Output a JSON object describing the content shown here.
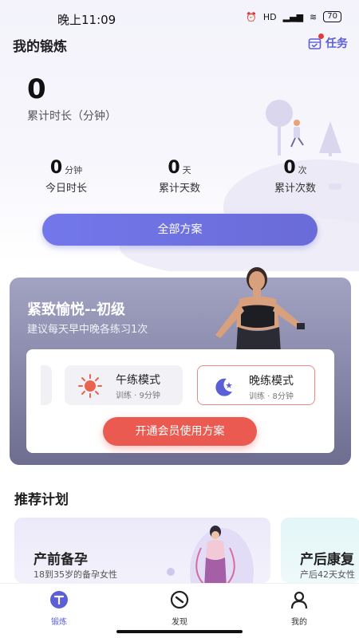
{
  "status_bar": {
    "time": "晚上11:09",
    "battery": "70",
    "hd": "HD"
  },
  "header": {
    "title": "我的锻炼",
    "task_label": "任务"
  },
  "summary": {
    "total_value": "0",
    "total_label": "累计时长（分钟）"
  },
  "stats": [
    {
      "value": "0",
      "unit": "分钟",
      "label": "今日时长"
    },
    {
      "value": "0",
      "unit": "天",
      "label": "累计天数"
    },
    {
      "value": "0",
      "unit": "次",
      "label": "累计次数"
    }
  ],
  "all_plans_button": "全部方案",
  "plan": {
    "title": "紧致愉悦--初级",
    "subtitle": "建议每天早中晚各练习1次",
    "modes": [
      {
        "name": "午练模式",
        "meta": "训练 · 9分钟",
        "icon": "sun-icon",
        "active": false
      },
      {
        "name": "晚练模式",
        "meta": "训练 · 8分钟",
        "icon": "moon-icon",
        "active": true
      }
    ],
    "vip_button": "开通会员使用方案"
  },
  "recommended": {
    "section_title": "推荐计划",
    "cards": [
      {
        "title": "产前备孕",
        "subtitle": "18到35岁的备孕女性"
      },
      {
        "title": "产后康复",
        "subtitle": "产后42天女性"
      }
    ]
  },
  "bottom_nav": [
    {
      "label": "锻炼",
      "icon": "workout-icon",
      "active": true
    },
    {
      "label": "发现",
      "icon": "compass-icon",
      "active": false
    },
    {
      "label": "我的",
      "icon": "profile-icon",
      "active": false
    }
  ],
  "colors": {
    "accent": "#5b5fd6",
    "button": "#6e72e4",
    "vip": "#ea5a50",
    "active_border": "#e58b82"
  }
}
